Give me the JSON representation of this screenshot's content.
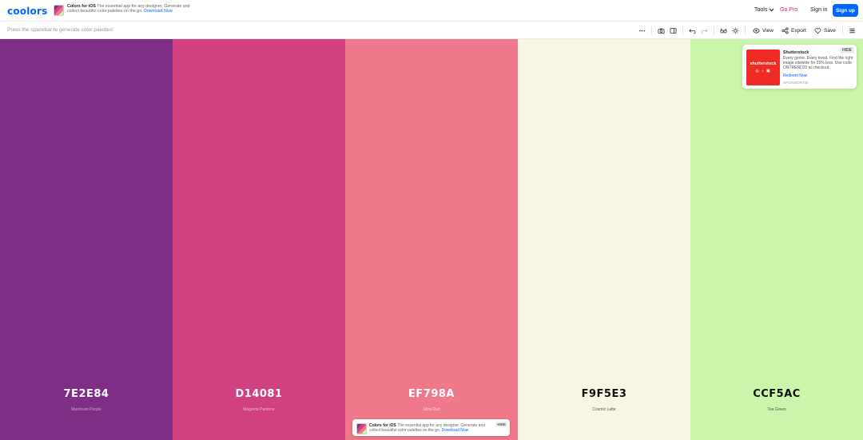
{
  "header": {
    "logo": "coolors",
    "promo": {
      "title": "Colors for iOS",
      "text": "The essential app for any designer. Generate and collect beautiful color palettes on the go.",
      "link": "Download Now"
    },
    "tools_label": "Tools",
    "gopro_label": "Go Pro",
    "signin_label": "Sign in",
    "signup_label": "Sign up"
  },
  "toolbar": {
    "hint": "Press the spacebar to generate color palettes!",
    "more_icon": "more-icon",
    "view_label": "View",
    "export_label": "Export",
    "save_label": "Save"
  },
  "palette": [
    {
      "hex": "7E2E84",
      "name": "Maximum Purple",
      "color": "#7e2e84",
      "text_color": "#ffffff",
      "name_color": "#c9a6cc"
    },
    {
      "hex": "D14081",
      "name": "Magenta Pantone",
      "color": "#d14081",
      "text_color": "#ffffff",
      "name_color": "#efb5cc"
    },
    {
      "hex": "EF798A",
      "name": "Ultra Red",
      "color": "#ef798a",
      "text_color": "#ffffff",
      "name_color": "#fcd0d6"
    },
    {
      "hex": "F9F5E3",
      "name": "Cosmic Latte",
      "color": "#f9f5e3",
      "text_color": "#111111",
      "name_color": "#555555"
    },
    {
      "hex": "CCF5AC",
      "name": "Tea Green",
      "color": "#ccf5ac",
      "text_color": "#111111",
      "name_color": "#555555"
    }
  ],
  "ad": {
    "hide_label": "HIDE",
    "brand": "shutterstock",
    "title": "Shutterstock",
    "body": "Every genre. Every trend. Find the right image sitewide for 25% less. Use code ONTREND25 at checkout.",
    "link": "Redeem Now",
    "sponsored": "SPONSORED"
  },
  "ios_card": {
    "hide_label": "HIDE",
    "title": "Colors for iOS",
    "text": "The essential app for any designer. Generate and collect beautiful color palettes on the go.",
    "link": "Download Now"
  }
}
